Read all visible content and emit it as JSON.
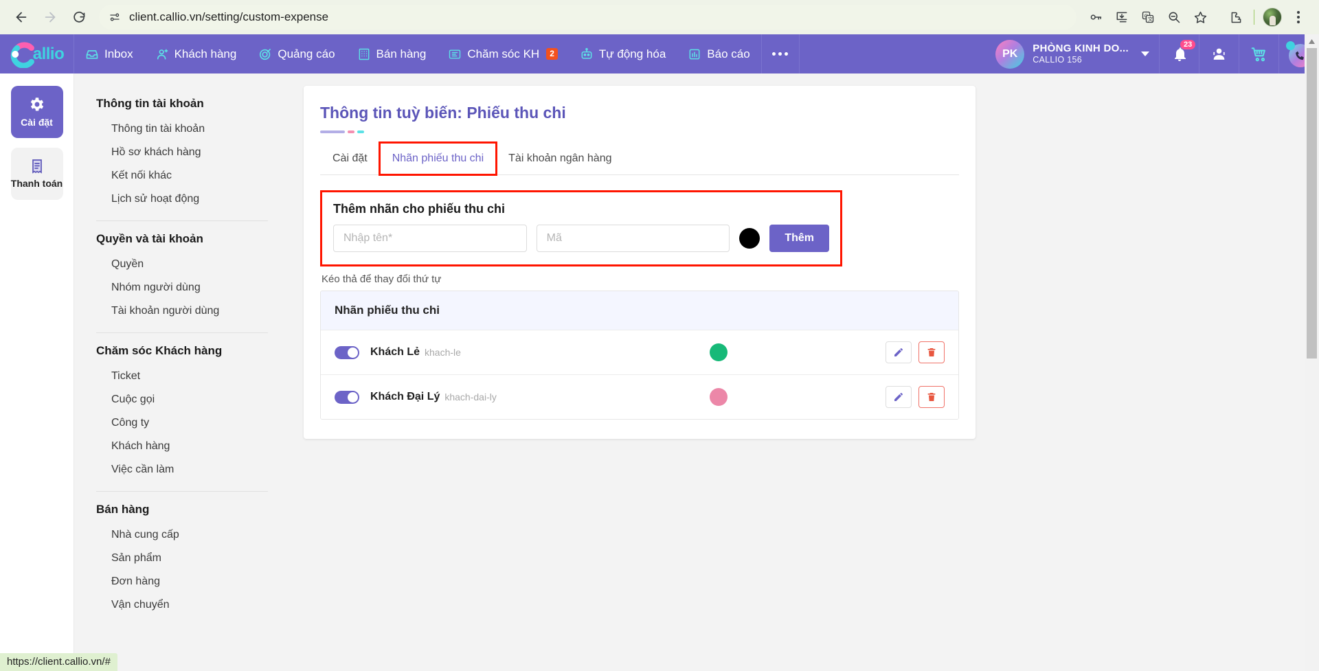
{
  "browser": {
    "url": "client.callio.vn/setting/custom-expense",
    "back_icon": "back-arrow-icon",
    "forward_icon": "forward-arrow-icon",
    "reload_icon": "reload-icon",
    "site_info_icon": "site-settings-icon",
    "actions": [
      "password-key-icon",
      "install-app-icon",
      "translate-icon",
      "zoom-out-icon",
      "bookmark-star-icon",
      "extensions-icon",
      "profile-avatar",
      "chrome-menu-icon"
    ],
    "status_text": "https://client.callio.vn/#"
  },
  "appbar": {
    "logo_text": "allio",
    "nav": [
      {
        "label": "Inbox",
        "icon": "inbox-icon",
        "badge": ""
      },
      {
        "label": "Khách hàng",
        "icon": "customer-icon",
        "badge": ""
      },
      {
        "label": "Quảng cáo",
        "icon": "target-ads-icon",
        "badge": ""
      },
      {
        "label": "Bán hàng",
        "icon": "building-sales-icon",
        "badge": ""
      },
      {
        "label": "Chăm sóc KH",
        "icon": "ticket-support-icon",
        "badge": "2"
      },
      {
        "label": "Tự động hóa",
        "icon": "robot-automation-icon",
        "badge": ""
      },
      {
        "label": "Báo cáo",
        "icon": "bar-chart-report-icon",
        "badge": ""
      }
    ],
    "more_icon": "more-horizontal-icon",
    "user": {
      "initials": "PK",
      "name": "PHÒNG KINH DO...",
      "sub": "CALLIO 156"
    },
    "notification_count": "23",
    "icons": [
      "bell-icon",
      "headset-agent-icon",
      "shopping-cart-icon",
      "phone-call-icon"
    ]
  },
  "rail": {
    "items": [
      {
        "label": "Cài đặt",
        "icon": "gear-icon",
        "active": true
      },
      {
        "label": "Thanh toán",
        "icon": "receipt-icon",
        "active": false
      }
    ]
  },
  "settings_nav": {
    "groups": [
      {
        "title": "Thông tin tài khoản",
        "items": [
          "Thông tin tài khoản",
          "Hồ sơ khách hàng",
          "Kết nối khác",
          "Lịch sử hoạt động"
        ]
      },
      {
        "title": "Quyền và tài khoản",
        "items": [
          "Quyền",
          "Nhóm người dùng",
          "Tài khoản người dùng"
        ]
      },
      {
        "title": "Chăm sóc Khách hàng",
        "items": [
          "Ticket",
          "Cuộc gọi",
          "Công ty",
          "Khách hàng",
          "Việc cần làm"
        ]
      },
      {
        "title": "Bán hàng",
        "items": [
          "Nhà cung cấp",
          "Sản phẩm",
          "Đơn hàng",
          "Vận chuyển"
        ]
      }
    ]
  },
  "main": {
    "title": "Thông tin tuỳ biến: Phiếu thu chi",
    "tabs": [
      {
        "label": "Cài đặt",
        "active": false,
        "highlighted": false
      },
      {
        "label": "Nhãn phiếu thu chi",
        "active": true,
        "highlighted": true
      },
      {
        "label": "Tài khoản ngân hàng",
        "active": false,
        "highlighted": false
      }
    ],
    "add_box": {
      "title": "Thêm nhãn cho phiếu thu chi",
      "name_placeholder": "Nhập tên*",
      "name_value": "",
      "code_placeholder": "Mã",
      "code_value": "",
      "color_value": "#000000",
      "submit_label": "Thêm"
    },
    "drag_hint": "Kéo thả để thay đổi thứ tự",
    "table": {
      "header": "Nhãn phiếu thu chi",
      "rows": [
        {
          "enabled": true,
          "name": "Khách Lẻ",
          "slug": "khach-le",
          "color": "#17b978",
          "edit_icon": "pencil-edit-icon",
          "delete_icon": "trash-delete-icon"
        },
        {
          "enabled": true,
          "name": "Khách Đại Lý",
          "slug": "khach-dai-ly",
          "color": "#ec87a8",
          "edit_icon": "pencil-edit-icon",
          "delete_icon": "trash-delete-icon"
        }
      ]
    }
  },
  "colors": {
    "brand_purple": "#6c63c7",
    "accent_cyan": "#5ce1e6",
    "highlight_red": "#ff1500",
    "title_purple": "#5b55b8"
  }
}
